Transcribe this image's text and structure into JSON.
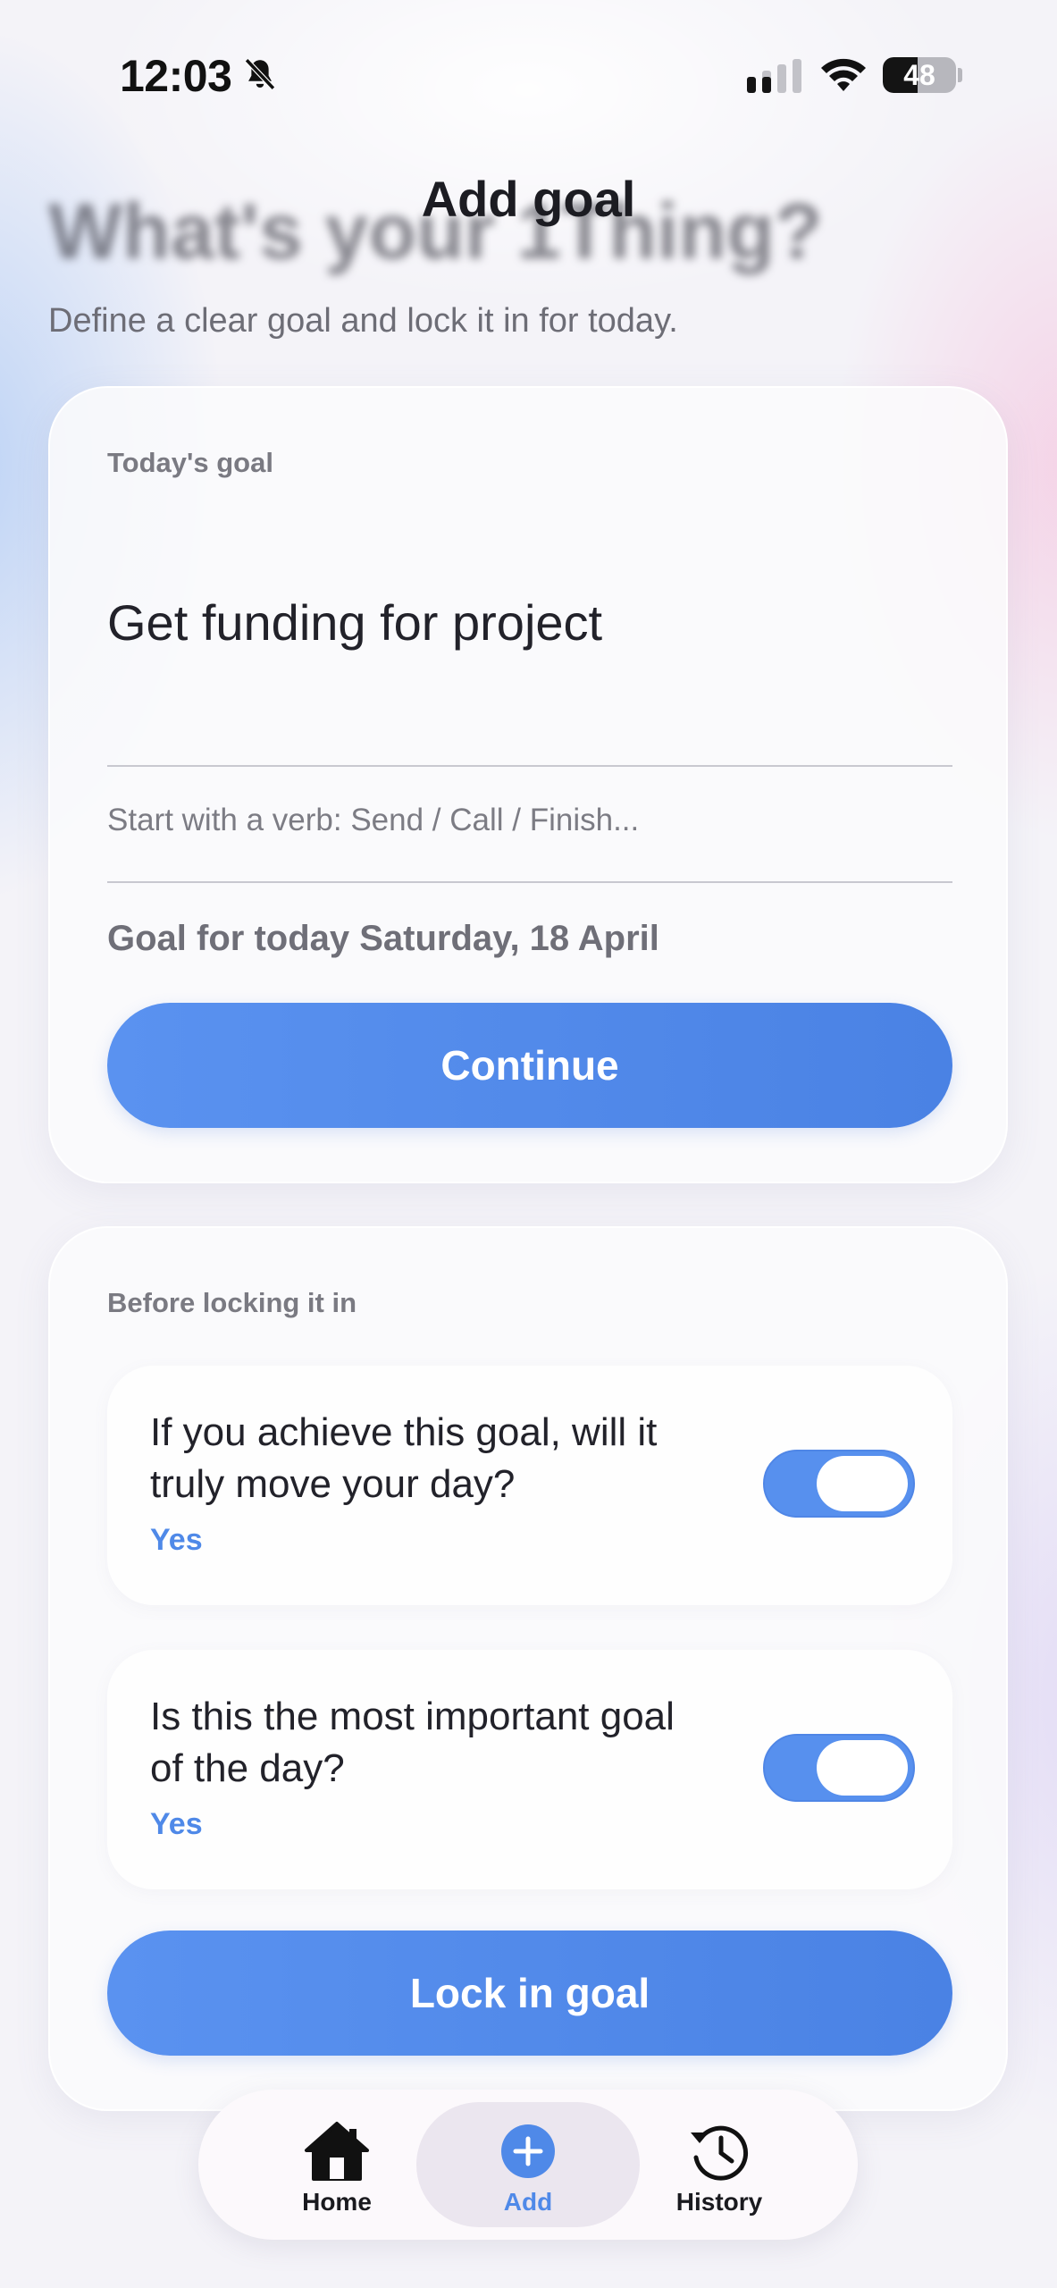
{
  "status_bar": {
    "time": "12:03",
    "battery": "48",
    "icons": [
      "bell-slash-icon",
      "cellular-signal-icon",
      "wifi-icon",
      "battery-icon"
    ]
  },
  "header": {
    "nav_title": "Add goal",
    "large_title": "What's your 1Thing?",
    "subtitle": "Define a clear goal and lock it in for today."
  },
  "goal_card": {
    "label": "Today's goal",
    "goal_value": "Get funding for project",
    "hint": "Start with a verb: Send / Call / Finish...",
    "date_text": "Goal for today Saturday, 18 April",
    "continue_label": "Continue"
  },
  "check_card": {
    "label": "Before locking it in",
    "questions": [
      {
        "text": "If you achieve this goal, will it truly move your day?",
        "answer": "Yes",
        "toggle_on": true
      },
      {
        "text": "Is this the most important goal of the day?",
        "answer": "Yes",
        "toggle_on": true
      }
    ],
    "lock_label": "Lock in goal"
  },
  "tab_bar": {
    "tabs": [
      {
        "label": "Home",
        "icon": "house-icon",
        "selected": false
      },
      {
        "label": "Add",
        "icon": "plus-circle-icon",
        "selected": true
      },
      {
        "label": "History",
        "icon": "history-icon",
        "selected": false
      }
    ]
  },
  "colors": {
    "accent": "#4f89e8",
    "button_gradient_start": "#5a92f0",
    "button_gradient_end": "#4a82e4"
  }
}
